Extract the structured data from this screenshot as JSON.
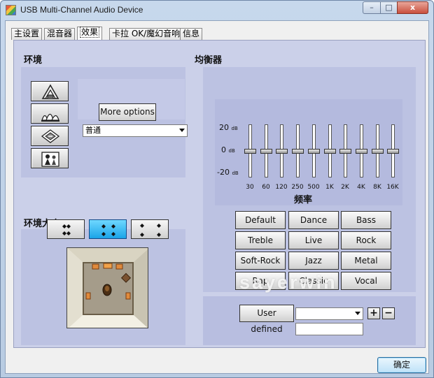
{
  "window": {
    "title": "USB Multi-Channel Audio Device",
    "controls": {
      "minimize": "–",
      "maximize": "□",
      "close": "x"
    }
  },
  "tabs": [
    {
      "label": "主设置",
      "active": false
    },
    {
      "label": "混音器",
      "active": false
    },
    {
      "label": "效果",
      "active": true
    },
    {
      "label": "卡拉 OK/魔幻音响",
      "active": false
    },
    {
      "label": "信息",
      "active": false
    }
  ],
  "environment": {
    "title": "环境",
    "icons": [
      "opera-house-icon",
      "sydney-opera-icon",
      "hallway-icon",
      "room-people-icon"
    ],
    "more_options": "More options",
    "selected_environment": "普通"
  },
  "environment_size": {
    "title": "环境大小",
    "options": [
      "small",
      "medium",
      "large"
    ],
    "selected_index": 1
  },
  "equalizer": {
    "title": "均衡器",
    "db_labels": {
      "top": "20",
      "mid": "0",
      "bottom": "-20",
      "unit": "dB"
    },
    "frequency_label": "频率",
    "bands": [
      {
        "freq": "30",
        "gain_db": 0
      },
      {
        "freq": "60",
        "gain_db": 0
      },
      {
        "freq": "120",
        "gain_db": 0
      },
      {
        "freq": "250",
        "gain_db": 0
      },
      {
        "freq": "500",
        "gain_db": 0
      },
      {
        "freq": "1K",
        "gain_db": 0
      },
      {
        "freq": "2K",
        "gain_db": 0
      },
      {
        "freq": "4K",
        "gain_db": 0
      },
      {
        "freq": "8K",
        "gain_db": 0
      },
      {
        "freq": "16K",
        "gain_db": 0
      }
    ],
    "presets": [
      "Default",
      "Dance",
      "Bass",
      "Treble",
      "Live",
      "Rock",
      "Soft-Rock",
      "Jazz",
      "Metal",
      "Rap",
      "Classic",
      "Vocal"
    ],
    "user_defined": "User defined",
    "add_label": "+",
    "remove_label": "−"
  },
  "watermark": "sayerwin",
  "ok_button": "确定"
}
